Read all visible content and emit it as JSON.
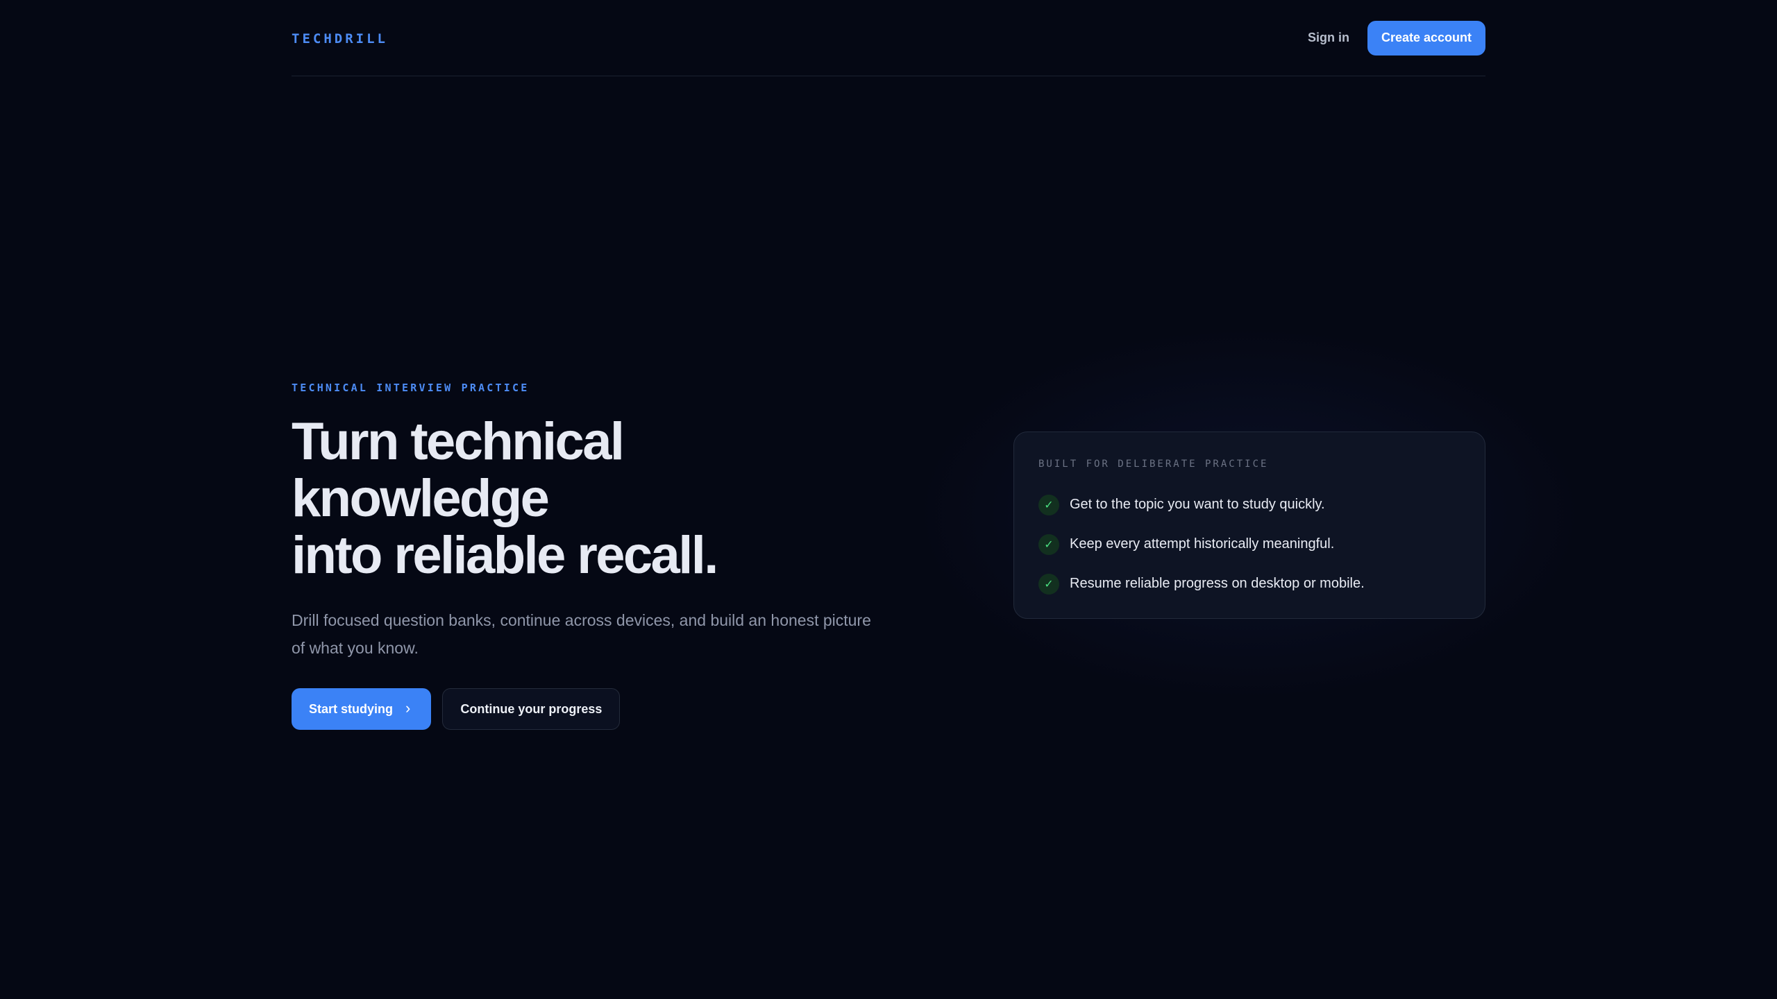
{
  "nav": {
    "brand": "TECHDRILL",
    "signin_label": "Sign in",
    "create_account_label": "Create account"
  },
  "hero": {
    "eyebrow": "TECHNICAL INTERVIEW PRACTICE",
    "headline_line1": "Turn technical knowledge",
    "headline_line2": "into reliable recall.",
    "subtext": "Drill focused question banks, continue across devices, and build an honest picture of what you know.",
    "primary_cta": "Start studying",
    "primary_cta_icon": "chevron-right-icon",
    "secondary_cta": "Continue your progress"
  },
  "card": {
    "eyebrow": "BUILT FOR DELIBERATE PRACTICE",
    "items": [
      {
        "icon": "check-icon",
        "text": "Get to the topic you want to study quickly."
      },
      {
        "icon": "check-icon",
        "text": "Keep every attempt historically meaningful."
      },
      {
        "icon": "check-icon",
        "text": "Resume reliable progress on desktop or mobile."
      }
    ]
  },
  "colors": {
    "background": "#050814",
    "accent": "#3b82f6",
    "card_bg": "#0e1424",
    "check_green": "#4ade80"
  }
}
